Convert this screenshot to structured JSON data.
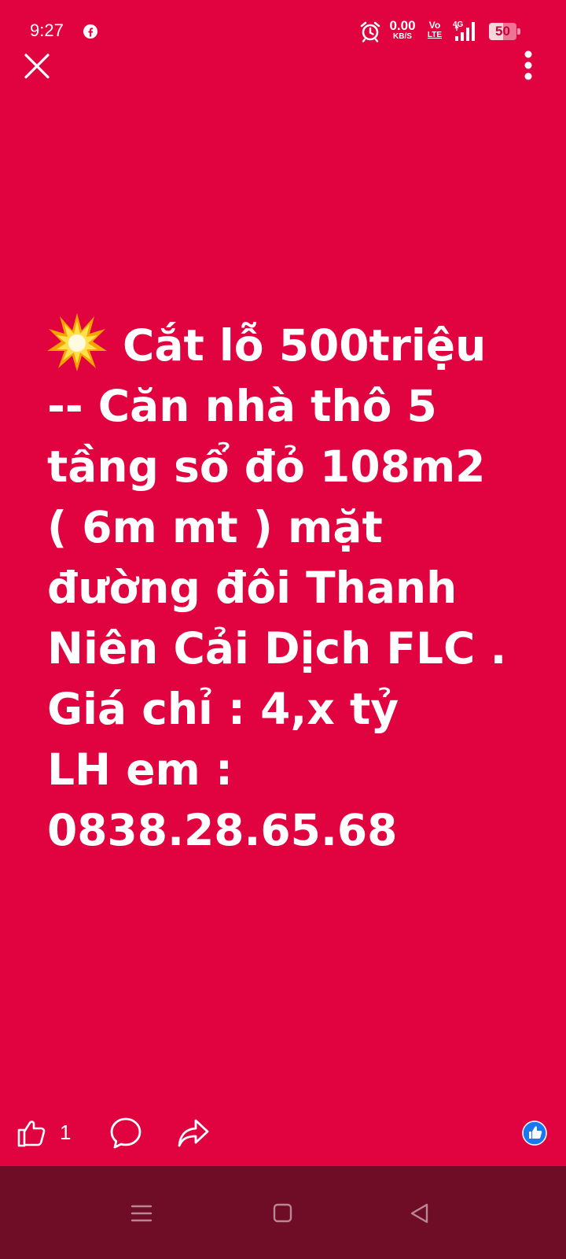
{
  "status_bar": {
    "time": "9:27",
    "net_speed_value": "0.00",
    "net_speed_unit": "KB/S",
    "volte_top": "Vo",
    "volte_bottom": "LTE",
    "network_type": "4G",
    "battery_level": "50",
    "battery_fraction": 0.5,
    "icons": [
      "facebook-icon",
      "alarm-icon",
      "signal-icon",
      "battery-icon"
    ]
  },
  "header": {
    "close_icon": "close-icon",
    "more_icon": "more-vertical-icon"
  },
  "post": {
    "background_color": "#e0033f",
    "text_color": "#ffffff",
    "leading_emoji": "collision-emoji",
    "lines": [
      "Cắt lỗ 500triệu",
      "-- Căn nhà thô 5",
      "tầng sổ đỏ 108m2",
      "( 6m mt ) mặt",
      "đường đôi Thanh",
      "Niên Cải Dịch FLC .",
      "Giá chỉ : 4,x tỷ",
      "LH em :",
      "0838.28.65.68"
    ]
  },
  "reactions": {
    "like_count": "1",
    "like_icon": "thumbs-up-icon",
    "comment_icon": "comment-icon",
    "share_icon": "share-icon",
    "badge_icon": "like-reaction-badge",
    "badge_color": "#1877f2"
  },
  "nav_bar": {
    "background_color": "#6e0d25",
    "icons": [
      "menu-icon",
      "home-square-icon",
      "back-triangle-icon"
    ]
  }
}
